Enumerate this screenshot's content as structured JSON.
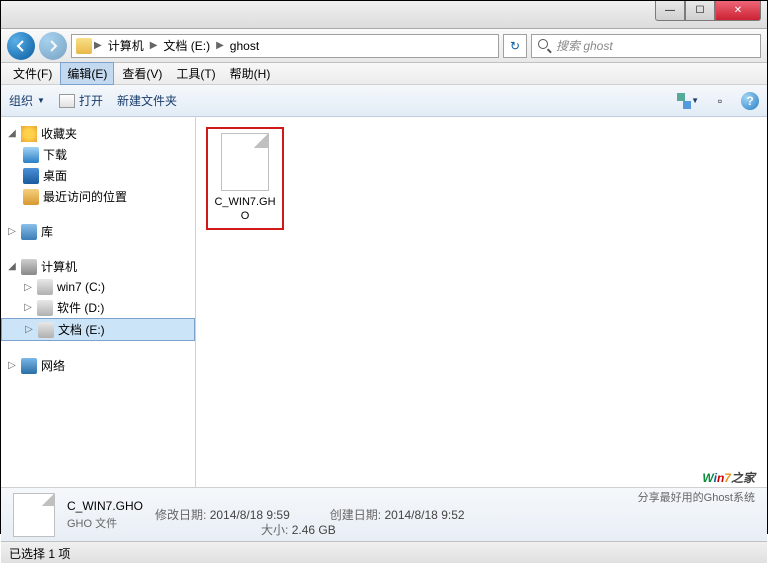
{
  "titlebar": {
    "min": "—",
    "max": "☐",
    "close": "✕"
  },
  "nav": {
    "breadcrumb": [
      "计算机",
      "文档 (E:)",
      "ghost"
    ],
    "search_placeholder": "搜索 ghost"
  },
  "menu": {
    "file": "文件(F)",
    "edit": "编辑(E)",
    "view": "查看(V)",
    "tools": "工具(T)",
    "help": "帮助(H)"
  },
  "toolbar": {
    "organize": "组织",
    "open": "打开",
    "newfolder": "新建文件夹"
  },
  "sidebar": {
    "favorites": {
      "label": "收藏夹",
      "items": [
        "下载",
        "桌面",
        "最近访问的位置"
      ]
    },
    "libraries": {
      "label": "库"
    },
    "computer": {
      "label": "计算机",
      "drives": [
        "win7 (C:)",
        "软件 (D:)",
        "文档 (E:)"
      ]
    },
    "network": {
      "label": "网络"
    }
  },
  "content": {
    "file": {
      "name": "C_WIN7.GHO"
    }
  },
  "details": {
    "name": "C_WIN7.GHO",
    "type": "GHO 文件",
    "mod_label": "修改日期:",
    "mod_value": "2014/8/18 9:59",
    "create_label": "创建日期:",
    "create_value": "2014/8/18 9:52",
    "size_label": "大小:",
    "size_value": "2.46 GB"
  },
  "status": {
    "text": "已选择 1 项"
  },
  "watermark": {
    "sub": "分享最好用的Ghost系统"
  }
}
